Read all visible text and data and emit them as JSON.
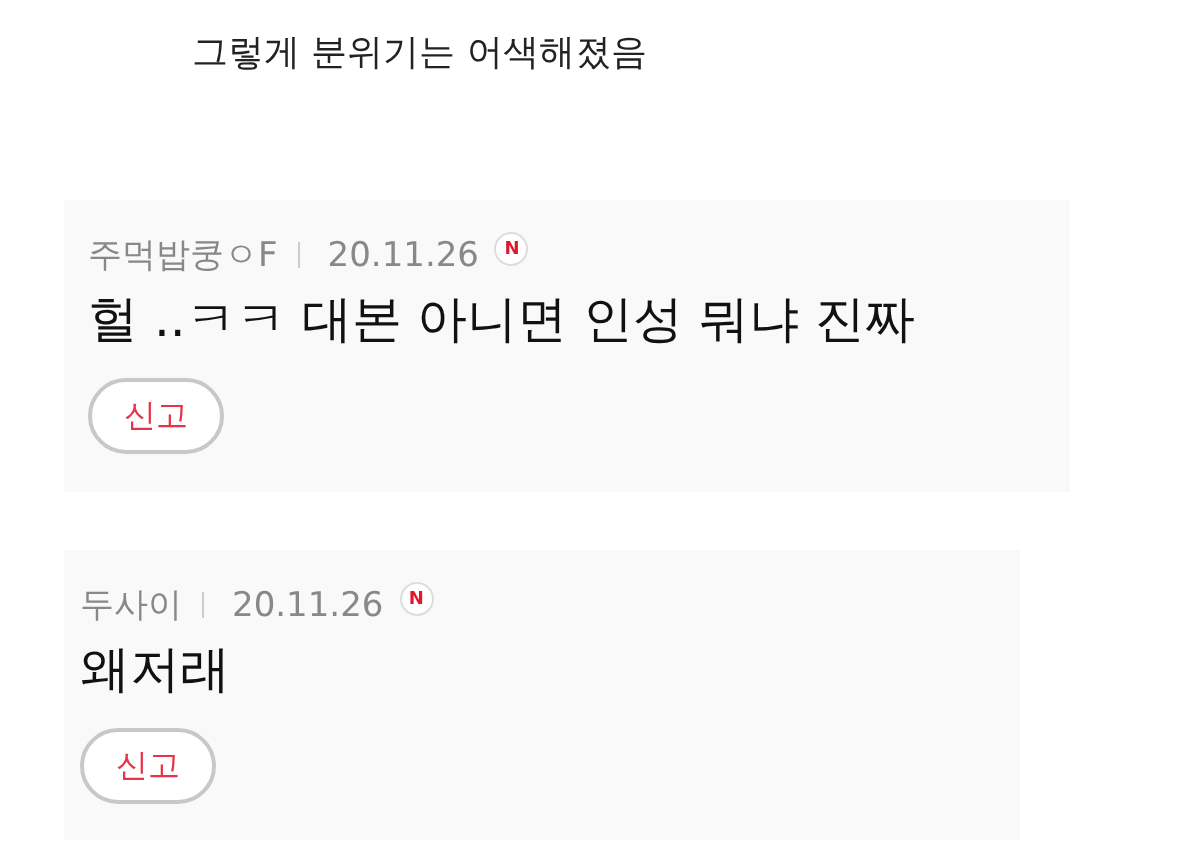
{
  "intro": "그렇게 분위기는 어색해졌음",
  "comments": [
    {
      "author": "주먹밥쿵ㅇF",
      "date": "20.11.26",
      "new_badge": "N",
      "text": "헐 ..ㅋㅋ 대본 아니면 인성 뭐냐 진짜",
      "report": "신고"
    },
    {
      "author": "두사이",
      "date": "20.11.26",
      "new_badge": "N",
      "text": "왜저래",
      "report": "신고"
    }
  ]
}
